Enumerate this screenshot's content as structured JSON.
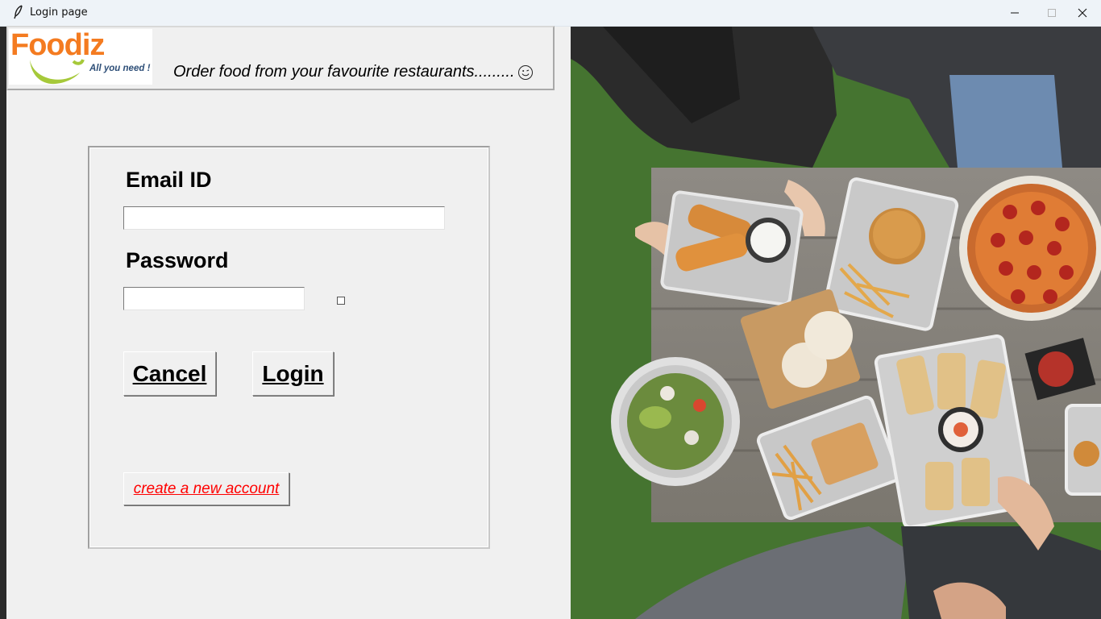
{
  "window": {
    "title": "Login page"
  },
  "header": {
    "logo_text": "Foodiz",
    "logo_tagline": "All you need !",
    "tagline": "Order food from your favourite restaurants........."
  },
  "form": {
    "email_label": "Email ID",
    "email_value": "",
    "password_label": "Password",
    "password_value": "",
    "show_password_checked": false,
    "cancel_label": "Cancel",
    "login_label": "Login",
    "create_account_label": "create a new account"
  },
  "colors": {
    "brand_orange": "#f47b20",
    "brand_green": "#a6c93a",
    "link_red": "#ff0000",
    "background": "#f0f0f0"
  },
  "icons": {
    "app": "feather-icon",
    "minimize": "minimize-icon",
    "maximize": "maximize-icon",
    "close": "close-icon",
    "emoji": "smiley-face-icon"
  }
}
